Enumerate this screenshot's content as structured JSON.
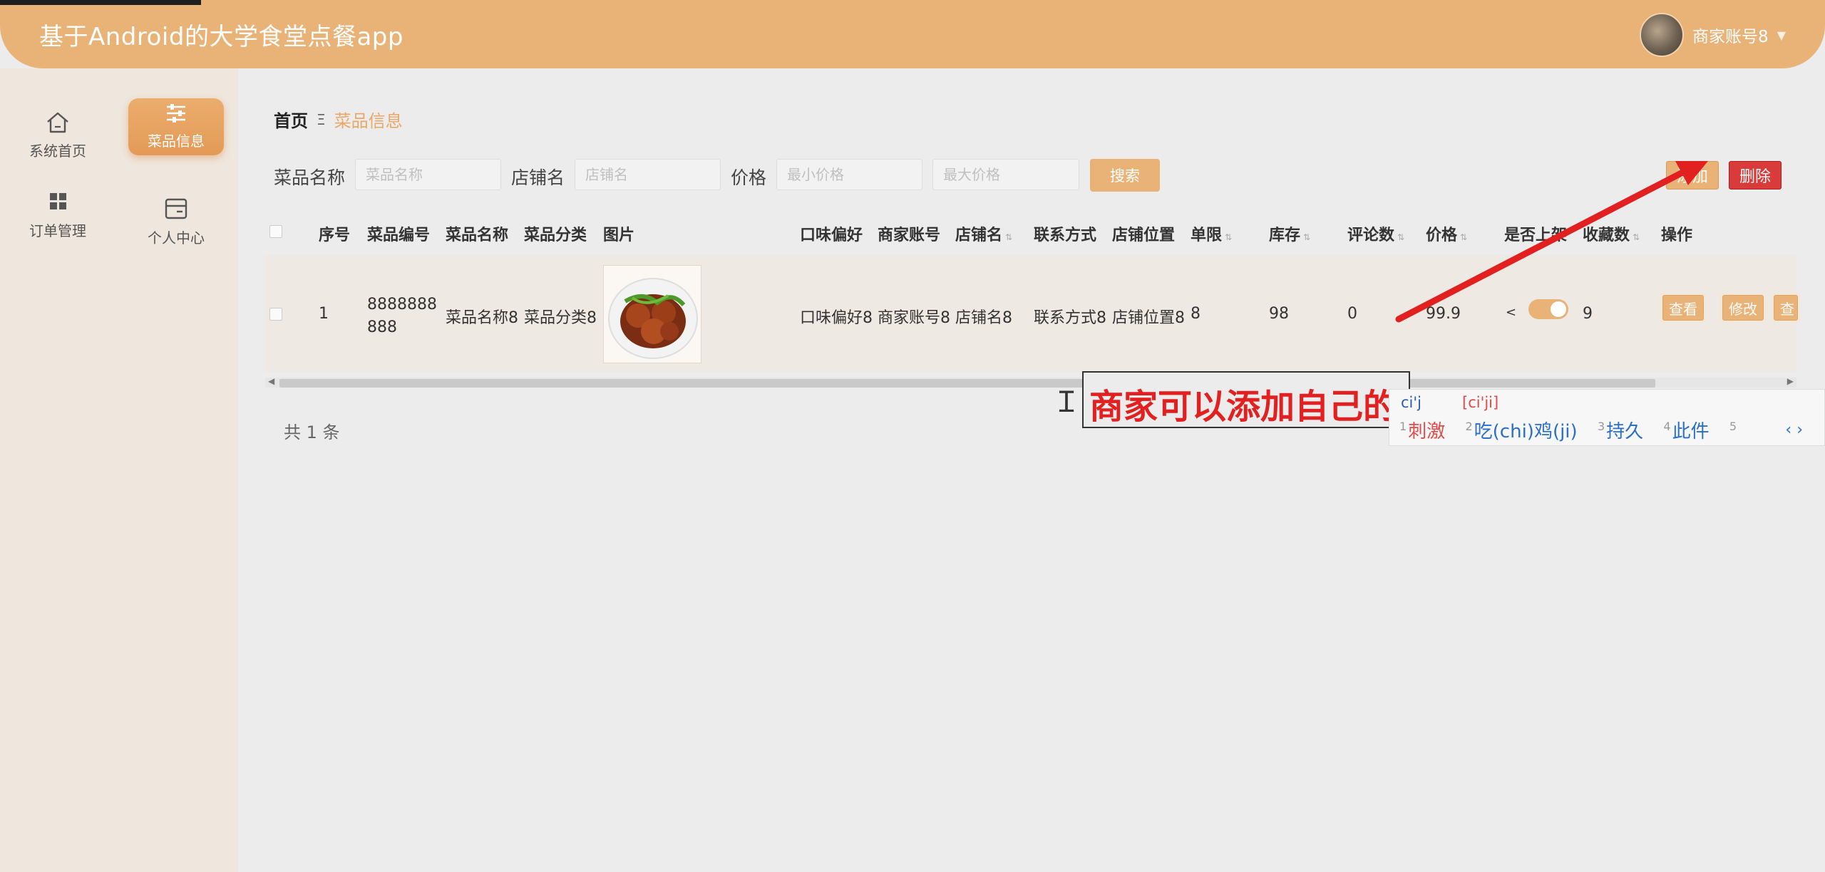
{
  "header": {
    "app_title": "基于Android的大学食堂点餐app",
    "username": "商家账号8"
  },
  "sidebar": {
    "items": [
      {
        "label": "系统首页",
        "icon": "home-icon"
      },
      {
        "label": "菜品信息",
        "icon": "sliders-icon",
        "active": true
      },
      {
        "label": "订单管理",
        "icon": "grid-icon"
      },
      {
        "label": "个人中心",
        "icon": "card-icon"
      }
    ]
  },
  "breadcrumb": {
    "home": "首页",
    "separator": "Ξ",
    "current": "菜品信息"
  },
  "filters": {
    "dish_name": {
      "label": "菜品名称",
      "placeholder": "菜品名称"
    },
    "shop_name": {
      "label": "店铺名",
      "placeholder": "店铺名"
    },
    "price": {
      "label": "价格",
      "min_placeholder": "最小价格",
      "max_placeholder": "最大价格"
    },
    "search_label": "搜索"
  },
  "toolbar": {
    "add_label": "添加",
    "delete_label": "删除"
  },
  "table": {
    "headers": [
      "序号",
      "菜品编号",
      "菜品名称",
      "菜品分类",
      "图片",
      "口味偏好",
      "商家账号",
      "店铺名",
      "联系方式",
      "店铺位置",
      "单限",
      "库存",
      "评论数",
      "价格",
      "是否上架",
      "收藏数",
      "操作"
    ],
    "rows": [
      {
        "index": "1",
        "code_line1": "8888888",
        "code_line2": "888",
        "name": "菜品名称8",
        "category": "菜品分类8",
        "taste": "口味偏好8",
        "merchant": "商家账号8",
        "shop": "店铺名8",
        "contact": "联系方式8",
        "location": "店铺位置8",
        "limit": "8",
        "stock": "98",
        "comments": "0",
        "price": "99.9",
        "on_sale": true,
        "favorites": "9",
        "actions": [
          "查看",
          "修改",
          "查"
        ]
      }
    ]
  },
  "pagination": {
    "total_text": "共 1 条"
  },
  "annotation": {
    "text": "商家可以添加自己的"
  },
  "ime": {
    "composition": "ci'j",
    "pinyin": "[ci'ji]",
    "candidates": [
      {
        "num": "1",
        "text": "刺激"
      },
      {
        "num": "2",
        "text": "吃(chi)鸡(ji)"
      },
      {
        "num": "3",
        "text": "持久"
      },
      {
        "num": "4",
        "text": "此件"
      },
      {
        "num": "5",
        "text": ""
      }
    ],
    "pager": "‹ ›"
  },
  "colors": {
    "accent": "#e9b277",
    "danger": "#d93b3b",
    "arrow": "#e32020"
  }
}
